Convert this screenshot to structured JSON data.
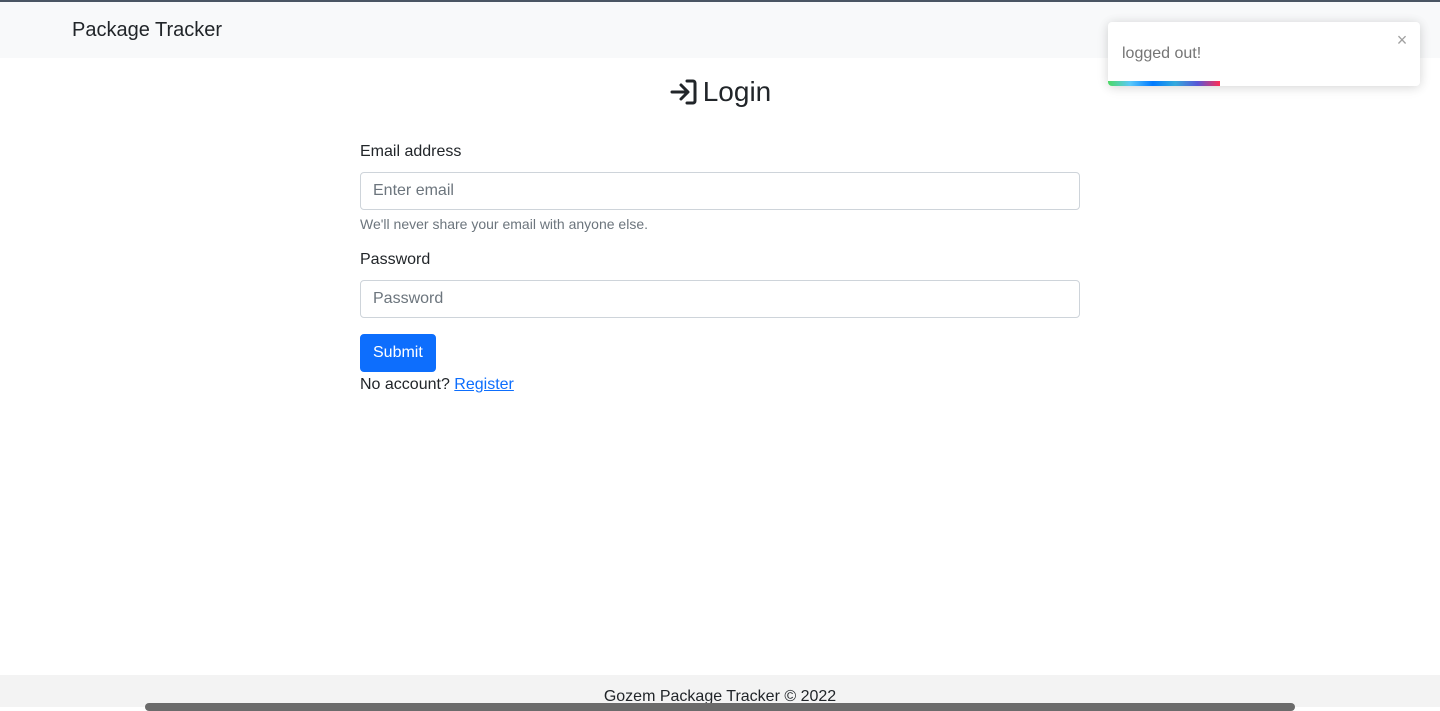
{
  "navbar": {
    "brand": "Package Tracker"
  },
  "login": {
    "title": "Login",
    "icon": "login-arrow-icon"
  },
  "form": {
    "email_label": "Email address",
    "email_placeholder": "Enter email",
    "email_value": "",
    "email_help": "We'll never share your email with anyone else.",
    "password_label": "Password",
    "password_placeholder": "Password",
    "password_value": "",
    "submit_label": "Submit",
    "no_account_text": "No account?",
    "register_link": "Register"
  },
  "toast": {
    "message": "logged out!",
    "close_symbol": "×",
    "progress_fraction": 0.36
  },
  "footer": {
    "text": "Gozem Package Tracker © 2022"
  },
  "colors": {
    "primary": "#0d6efd",
    "navbar_bg": "#f8f9fa",
    "footer_bg": "#f3f3f3"
  }
}
